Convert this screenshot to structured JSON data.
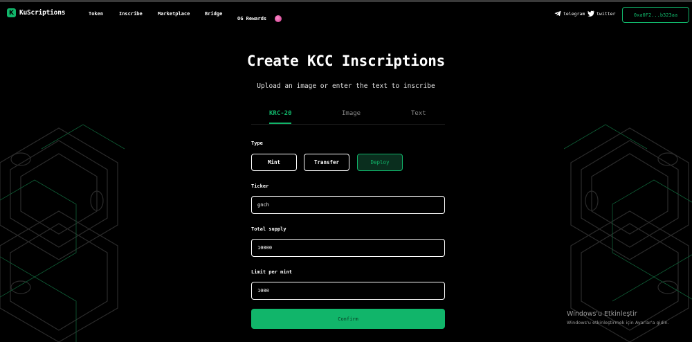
{
  "nav": {
    "logo_letter": "K",
    "logo_text": "KuScriptions",
    "links": [
      "Token",
      "Inscribe",
      "Marketplace",
      "Bridge",
      "OG Rewards"
    ],
    "telegram": "telegram",
    "twitter": "twitter",
    "wallet": "0xa0F2...b323aa"
  },
  "hero": {
    "title": "Create KCC Inscriptions",
    "subtitle": "Upload an image or enter the text to inscribe"
  },
  "tabs": [
    "KRC-20",
    "Image",
    "Text"
  ],
  "active_tab": "KRC-20",
  "form": {
    "type_label": "Type",
    "type_options": [
      "Mint",
      "Transfer",
      "Deploy"
    ],
    "selected_type": "Deploy",
    "ticker_label": "Ticker",
    "ticker_value": "gnch",
    "supply_label": "Total supply",
    "supply_value": "10000",
    "limit_label": "Limit per mint",
    "limit_value": "1000",
    "confirm_label": "Confirm"
  },
  "watermark": {
    "title": "Windows'u Etkinleştir",
    "subtitle": "Windows'u etkinleştirmek için Ayarlar'a gidin."
  },
  "colors": {
    "accent": "#11b56a",
    "background": "#000000"
  },
  "icons": [
    "telegram-icon",
    "twitter-icon",
    "fire-icon"
  ]
}
